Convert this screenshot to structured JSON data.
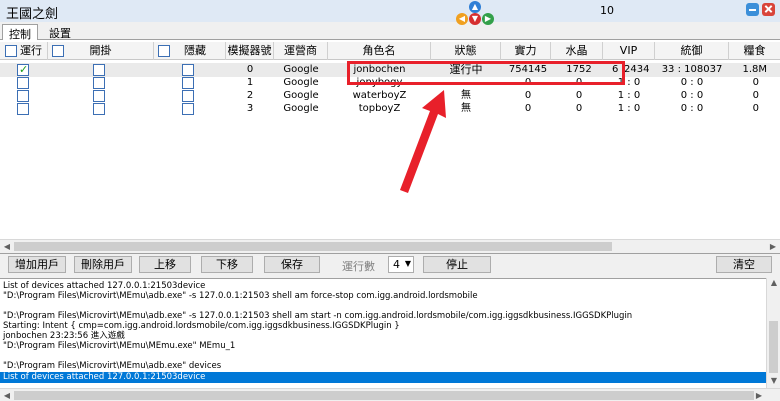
{
  "window": {
    "title": "王國之劍",
    "counter": "10"
  },
  "tabs": [
    {
      "label": "控制"
    },
    {
      "label": "設置"
    }
  ],
  "table": {
    "headers": {
      "run": "運行",
      "hang": "開掛",
      "hide": "隱藏",
      "emu": "模擬器號",
      "operator": "運營商",
      "name": "角色名",
      "status": "狀態",
      "power": "實力",
      "crystal": "水晶",
      "vip": "VIP",
      "command": "統御",
      "food": "糧食"
    },
    "rows": [
      {
        "emu": "0",
        "operator": "Google",
        "name": "jonbochen",
        "status": "運行中",
        "power": "754145",
        "crystal": "1752",
        "vip": "6",
        "vip_tail": "2434",
        "command": "33 : 108037",
        "food": "1.8M",
        "run_checked": true
      },
      {
        "emu": "1",
        "operator": "Google",
        "name": "jonybogy",
        "status": "",
        "power": "0",
        "crystal": "0",
        "vip": "1 : 0",
        "vip_tail": "",
        "command": "0 : 0",
        "food": "0",
        "run_checked": false
      },
      {
        "emu": "2",
        "operator": "Google",
        "name": "waterboyZ",
        "status": "無",
        "power": "0",
        "crystal": "0",
        "vip": "1 : 0",
        "vip_tail": "",
        "command": "0 : 0",
        "food": "0",
        "run_checked": false
      },
      {
        "emu": "3",
        "operator": "Google",
        "name": "topboyZ",
        "status": "無",
        "power": "0",
        "crystal": "0",
        "vip": "1 : 0",
        "vip_tail": "",
        "command": "0 : 0",
        "food": "0",
        "run_checked": false
      }
    ]
  },
  "toolbar": {
    "add_user": "增加用戶",
    "delete_user": "刪除用戶",
    "move_up": "上移",
    "move_down": "下移",
    "save": "保存",
    "run_count_label": "運行數",
    "run_count_value": "4",
    "stop": "停止",
    "clear": "清空"
  },
  "log": {
    "lines": [
      "List of devices attached 127.0.0.1:21503device",
      "\"D:\\Program Files\\Microvirt\\MEmu\\adb.exe\" -s 127.0.0.1:21503 shell am force-stop com.igg.android.lordsmobile",
      "",
      "\"D:\\Program Files\\Microvirt\\MEmu\\adb.exe\" -s 127.0.0.1:21503 shell am start -n com.igg.android.lordsmobile/com.igg.iggsdkbusiness.IGGSDKPlugin",
      "Starting: Intent { cmp=com.igg.android.lordsmobile/com.igg.iggsdkbusiness.IGGSDKPlugin }",
      "jonbochen   23:23:56  進入遊戲",
      "\"D:\\Program Files\\Microvirt\\MEmu\\MEmu.exe\" MEmu_1",
      "",
      "\"D:\\Program Files\\Microvirt\\MEmu\\adb.exe\" devices",
      "List of devices attached 127.0.0.1:21503device"
    ]
  },
  "colors": {
    "highlight": "#0078d7",
    "annotation": "#e8202a",
    "titlebar": "#dfe9f5"
  }
}
